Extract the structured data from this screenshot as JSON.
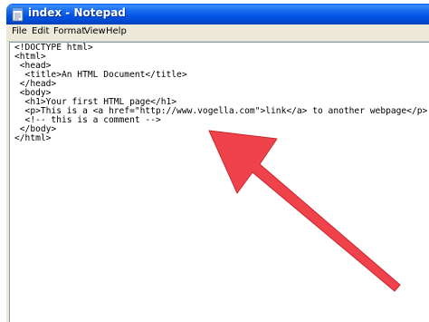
{
  "window": {
    "title": "index - Notepad",
    "icon": "notepad-icon"
  },
  "menu": {
    "items": [
      {
        "label": "File"
      },
      {
        "label": "Edit"
      },
      {
        "label": "Format"
      },
      {
        "label": "View"
      },
      {
        "label": "Help"
      }
    ]
  },
  "editor": {
    "lines": [
      "<!DOCTYPE html>",
      "<html>",
      " <head>",
      "  <title>An HTML Document</title>",
      " </head>",
      " <body>",
      "  <h1>Your first HTML page</h1>",
      "  <p>This is a <a href=\"http://www.vogella.com\">link</a> to another webpage</p>",
      "  <!-- this is a comment -->",
      " </body>",
      "</html>"
    ]
  },
  "annotation": {
    "icon": "red-arrow-icon",
    "color": "#f0424a"
  }
}
